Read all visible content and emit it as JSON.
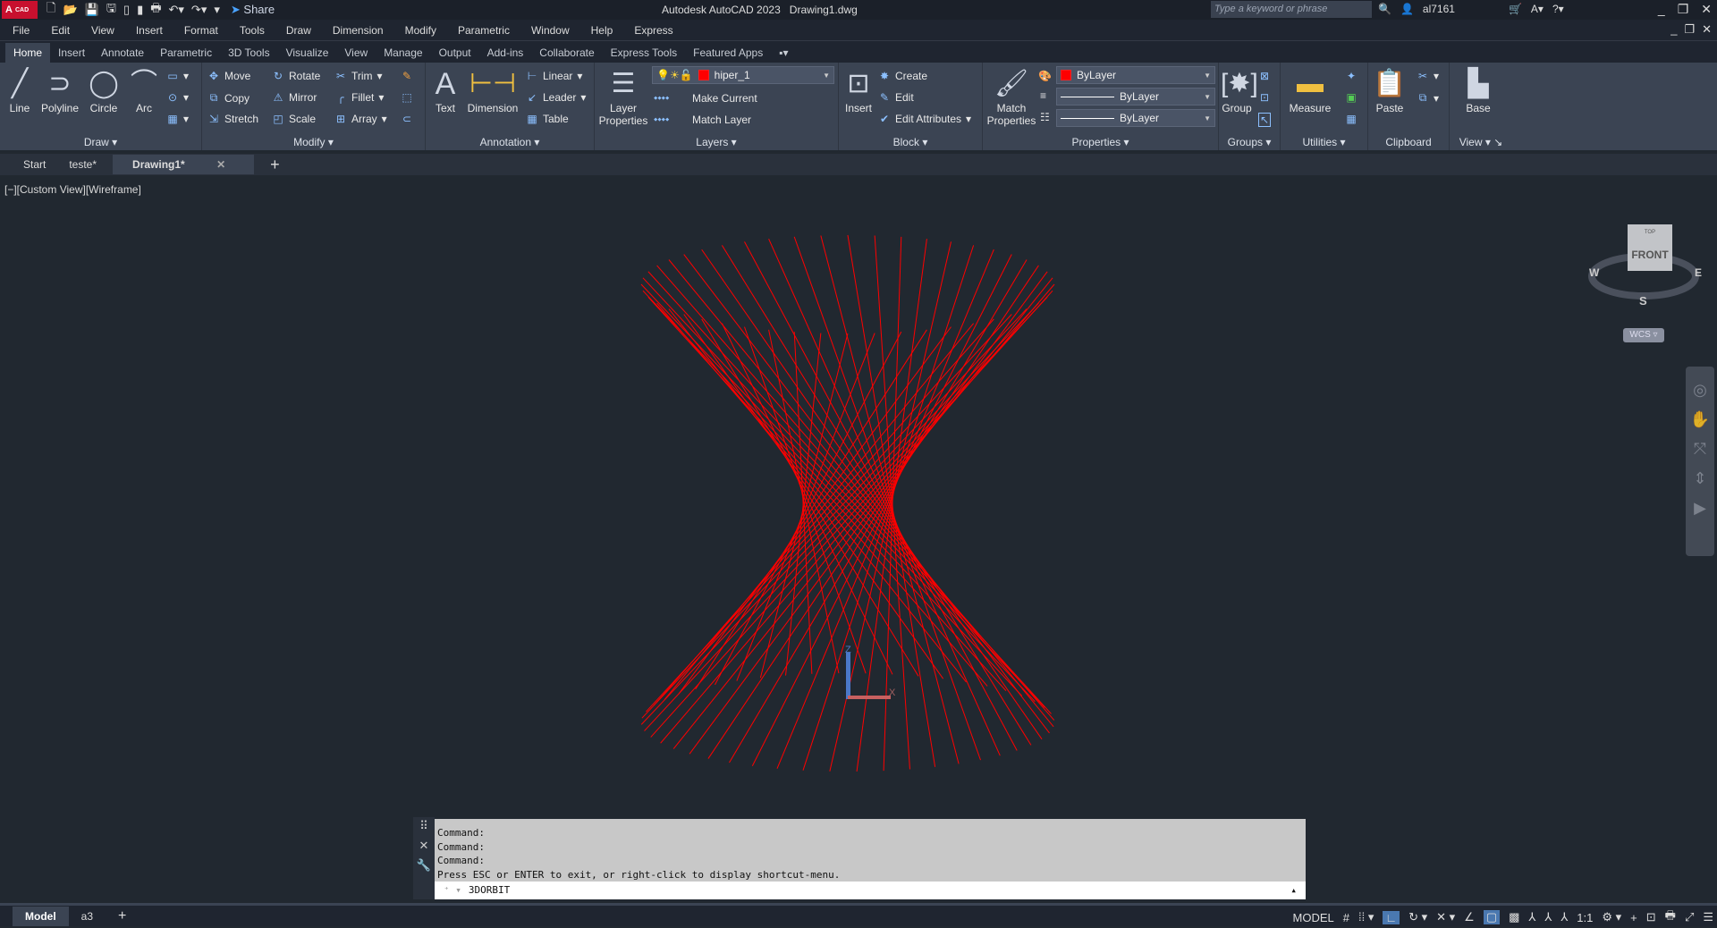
{
  "app": {
    "logo": "A",
    "logo_sub": "CAD",
    "title": "Autodesk AutoCAD 2023",
    "document": "Drawing1.dwg",
    "share": "Share",
    "search_placeholder": "Type a keyword or phrase",
    "user": "al7161"
  },
  "menu": [
    "File",
    "Edit",
    "View",
    "Insert",
    "Format",
    "Tools",
    "Draw",
    "Dimension",
    "Modify",
    "Parametric",
    "Window",
    "Help",
    "Express"
  ],
  "ribbon_tabs": [
    "Home",
    "Insert",
    "Annotate",
    "Parametric",
    "3D Tools",
    "Visualize",
    "View",
    "Manage",
    "Output",
    "Add-ins",
    "Collaborate",
    "Express Tools",
    "Featured Apps"
  ],
  "ribbon": {
    "draw": {
      "title": "Draw",
      "line": "Line",
      "polyline": "Polyline",
      "circle": "Circle",
      "arc": "Arc"
    },
    "modify": {
      "title": "Modify",
      "move": "Move",
      "rotate": "Rotate",
      "trim": "Trim",
      "copy": "Copy",
      "mirror": "Mirror",
      "fillet": "Fillet",
      "stretch": "Stretch",
      "scale": "Scale",
      "array": "Array"
    },
    "annotation": {
      "title": "Annotation",
      "text": "Text",
      "dimension": "Dimension",
      "linear": "Linear",
      "leader": "Leader",
      "table": "Table"
    },
    "layers": {
      "title": "Layers",
      "layer_properties": "Layer Properties",
      "current_layer": "hiper_1",
      "make_current": "Make Current",
      "match_layer": "Match Layer"
    },
    "block": {
      "title": "Block",
      "insert": "Insert",
      "create": "Create",
      "edit": "Edit",
      "edit_attributes": "Edit Attributes"
    },
    "properties": {
      "title": "Properties",
      "match": "Match Properties",
      "color": "ByLayer",
      "linetype": "ByLayer",
      "lineweight": "ByLayer"
    },
    "groups": {
      "title": "Groups",
      "group": "Group"
    },
    "utilities": {
      "title": "Utilities",
      "measure": "Measure"
    },
    "clipboard": {
      "title": "Clipboard",
      "paste": "Paste"
    },
    "view": {
      "title": "View",
      "base": "Base"
    }
  },
  "file_tabs": {
    "start": "Start",
    "items": [
      "teste*",
      "Drawing1*"
    ]
  },
  "viewport": {
    "label": "[−][Custom View][Wireframe]",
    "cube_face": "FRONT",
    "cube_top": "TOP",
    "compass": {
      "w": "W",
      "e": "E",
      "s": "S"
    },
    "wcs": "WCS",
    "ucs_x": "X",
    "ucs_z": "Z",
    "line_color": "#ff0000"
  },
  "command": {
    "history": [
      "Command:",
      "Command:",
      "Command:",
      "Press ESC or ENTER to exit, or right-click to display shortcut-menu."
    ],
    "input": "3DORBIT"
  },
  "layouts": [
    "Model",
    "a3"
  ],
  "status": {
    "model": "MODEL",
    "scale": "1:1"
  }
}
